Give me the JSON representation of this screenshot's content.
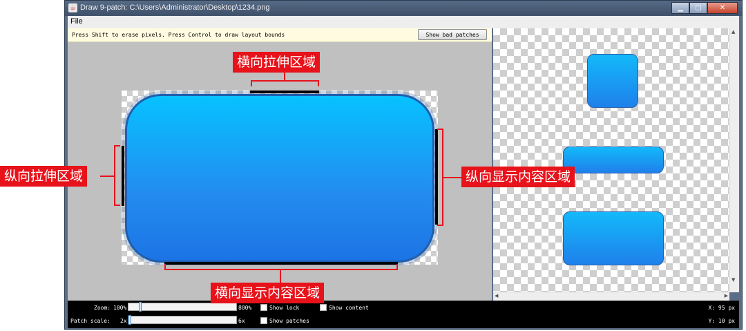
{
  "window": {
    "title": "Draw 9-patch: C:\\Users\\Administrator\\Desktop\\1234.png",
    "buttons": {
      "minimize": "▁",
      "maximize": "□",
      "close": "✕"
    }
  },
  "menubar": {
    "file": "File"
  },
  "editor": {
    "hint": "Press Shift to erase pixels. Press Control to draw layout bounds",
    "bad_patches_button": "Show bad patches"
  },
  "controls": {
    "zoom_label": "Zoom:",
    "zoom_min": "100%",
    "zoom_max": "800%",
    "patch_scale_label": "Patch scale:",
    "patch_scale_min": "2x",
    "patch_scale_max": "6x",
    "show_lock": "Show lock",
    "show_content": "Show content",
    "show_patches": "Show patches",
    "x_readout": "X: 95 px",
    "y_readout": "Y: 10 px",
    "zoom_level": 0.1,
    "patch_scale_level": 0.0
  },
  "annotations": {
    "top": "横向拉伸区域",
    "left": "纵向拉伸区域",
    "right": "纵向显示内容区域",
    "bottom": "横向显示内容区域"
  },
  "colors": {
    "accent": "#e8121a",
    "button_top": "#07c2ff",
    "button_bottom": "#1c74e4"
  },
  "icons": [
    "java-cup-icon",
    "minimize-icon",
    "maximize-icon",
    "close-icon",
    "scroll-up-icon",
    "scroll-down-icon",
    "scroll-left-icon",
    "scroll-right-icon"
  ]
}
